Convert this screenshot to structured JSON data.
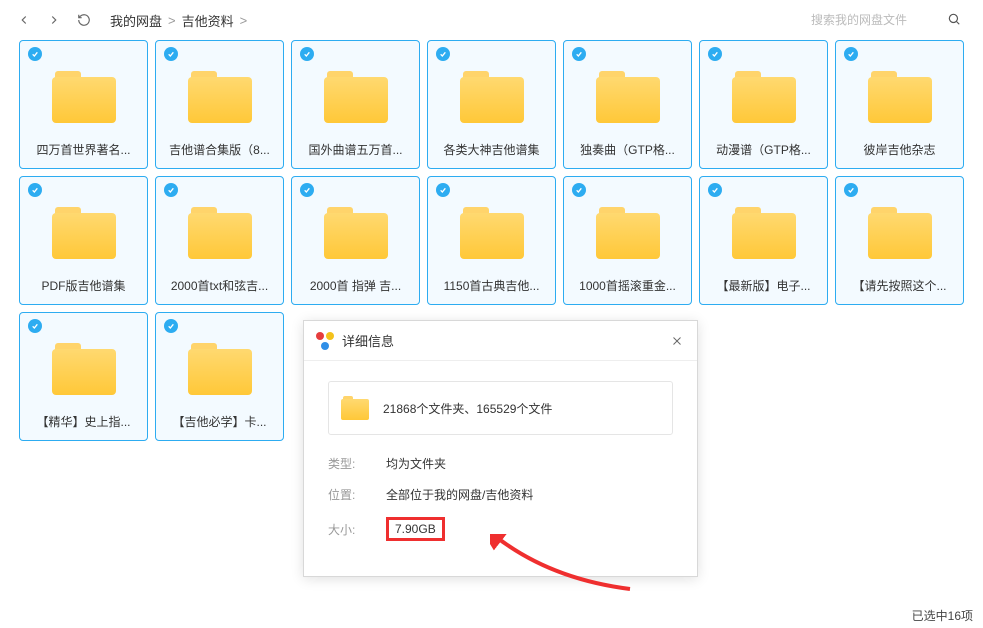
{
  "breadcrumb": {
    "root": "我的网盘",
    "current": "吉他资料"
  },
  "search": {
    "placeholder": "搜索我的网盘文件"
  },
  "tiles": [
    {
      "label": "四万首世界著名..."
    },
    {
      "label": "吉他谱合集版（8..."
    },
    {
      "label": "国外曲谱五万首..."
    },
    {
      "label": "各类大神吉他谱集"
    },
    {
      "label": "独奏曲（GTP格..."
    },
    {
      "label": "动漫谱（GTP格..."
    },
    {
      "label": "彼岸吉他杂志"
    },
    {
      "label": "PDF版吉他谱集"
    },
    {
      "label": "2000首txt和弦吉..."
    },
    {
      "label": "2000首 指弹 吉..."
    },
    {
      "label": "1150首古典吉他..."
    },
    {
      "label": "1000首摇滚重金..."
    },
    {
      "label": "【最新版】电子..."
    },
    {
      "label": "【请先按照这个..."
    },
    {
      "label": "【精华】史上指..."
    },
    {
      "label": "【吉他必学】卡..."
    }
  ],
  "popup": {
    "title": "详细信息",
    "summary": "21868个文件夹、165529个文件",
    "type_label": "类型:",
    "type_value": "均为文件夹",
    "loc_label": "位置:",
    "loc_value": "全部位于我的网盘/吉他资料",
    "size_label": "大小:",
    "size_value": "7.90GB"
  },
  "status": "已选中16项"
}
